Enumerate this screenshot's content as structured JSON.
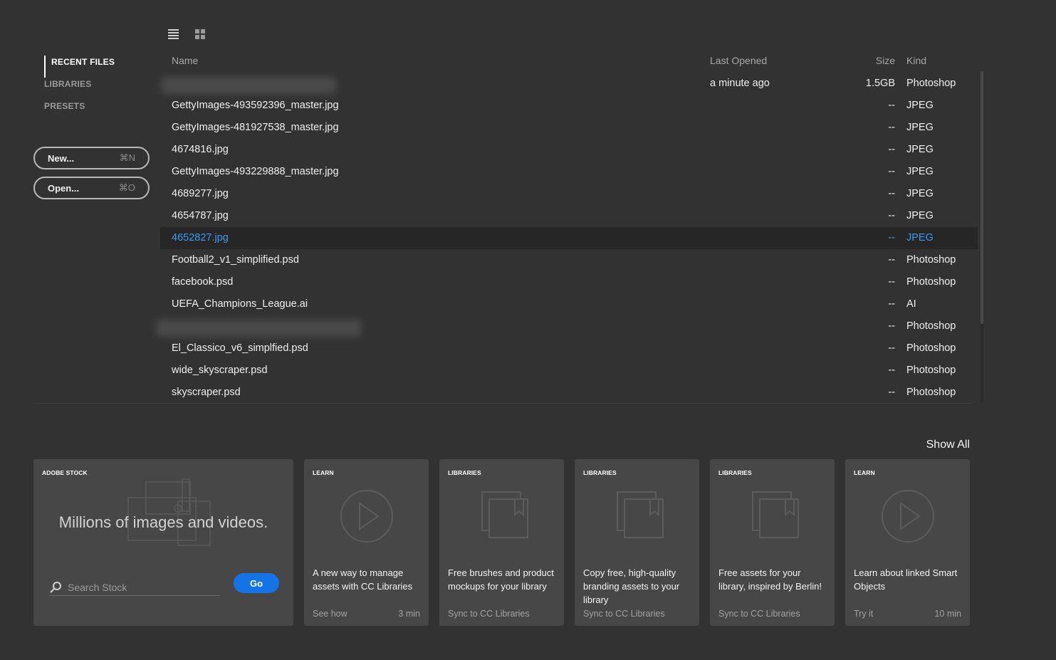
{
  "view_toggles": {
    "list_icon": "list-view-icon",
    "grid_icon": "grid-view-icon"
  },
  "sidebar": {
    "nav": [
      {
        "label": "RECENT FILES",
        "active": true
      },
      {
        "label": "LIBRARIES",
        "active": false
      },
      {
        "label": "PRESETS",
        "active": false
      }
    ],
    "new_button": {
      "label": "New...",
      "shortcut": "⌘N"
    },
    "open_button": {
      "label": "Open...",
      "shortcut": "⌘O"
    }
  },
  "files": {
    "columns": {
      "name": "Name",
      "last_opened": "Last Opened",
      "size": "Size",
      "kind": "Kind"
    },
    "rows": [
      {
        "name": "",
        "last_opened": "a minute ago",
        "size": "1.5GB",
        "kind": "Photoshop",
        "blurred": true
      },
      {
        "name": "GettyImages-493592396_master.jpg",
        "last_opened": "",
        "size": "--",
        "kind": "JPEG"
      },
      {
        "name": "GettyImages-481927538_master.jpg",
        "last_opened": "",
        "size": "--",
        "kind": "JPEG"
      },
      {
        "name": "4674816.jpg",
        "last_opened": "",
        "size": "--",
        "kind": "JPEG"
      },
      {
        "name": "GettyImages-493229888_master.jpg",
        "last_opened": "",
        "size": "--",
        "kind": "JPEG"
      },
      {
        "name": "4689277.jpg",
        "last_opened": "",
        "size": "--",
        "kind": "JPEG"
      },
      {
        "name": "4654787.jpg",
        "last_opened": "",
        "size": "--",
        "kind": "JPEG"
      },
      {
        "name": "4652827.jpg",
        "last_opened": "",
        "size": "--",
        "kind": "JPEG",
        "selected": true
      },
      {
        "name": "Football2_v1_simplified.psd",
        "last_opened": "",
        "size": "--",
        "kind": "Photoshop"
      },
      {
        "name": "facebook.psd",
        "last_opened": "",
        "size": "--",
        "kind": "Photoshop"
      },
      {
        "name": "UEFA_Champions_League.ai",
        "last_opened": "",
        "size": "--",
        "kind": "AI"
      },
      {
        "name": "",
        "last_opened": "",
        "size": "--",
        "kind": "Photoshop",
        "blurred": true
      },
      {
        "name": "El_Classico_v6_simplfied.psd",
        "last_opened": "",
        "size": "--",
        "kind": "Photoshop"
      },
      {
        "name": "wide_skyscraper.psd",
        "last_opened": "",
        "size": "--",
        "kind": "Photoshop"
      },
      {
        "name": "skyscraper.psd",
        "last_opened": "",
        "size": "--",
        "kind": "Photoshop"
      }
    ]
  },
  "show_all": "Show All",
  "stock_card": {
    "tag": "ADOBE STOCK",
    "headline": "Millions of images and videos.",
    "search_placeholder": "Search Stock",
    "go_label": "Go"
  },
  "cards": [
    {
      "tag": "LEARN",
      "icon": "play-icon",
      "title": "A new way to manage assets with CC Libraries",
      "foot_left": "See how",
      "foot_right": "3 min"
    },
    {
      "tag": "LIBRARIES",
      "icon": "library-icon",
      "title": "Free brushes and product mockups for your library",
      "foot_left": "Sync to CC Libraries",
      "foot_right": ""
    },
    {
      "tag": "LIBRARIES",
      "icon": "library-icon",
      "title": "Copy free, high-quality branding assets to your library",
      "foot_left": "Sync to CC Libraries",
      "foot_right": ""
    },
    {
      "tag": "LIBRARIES",
      "icon": "library-icon",
      "title": "Free assets for your library, inspired by Berlin!",
      "foot_left": "Sync to CC Libraries",
      "foot_right": ""
    },
    {
      "tag": "LEARN",
      "icon": "play-icon",
      "title": "Learn about linked Smart Objects",
      "foot_left": "Try it",
      "foot_right": "10 min"
    }
  ],
  "colors": {
    "background": "#323232",
    "card": "#474747",
    "accent": "#1473e6",
    "selected_text": "#3d9bf2"
  }
}
